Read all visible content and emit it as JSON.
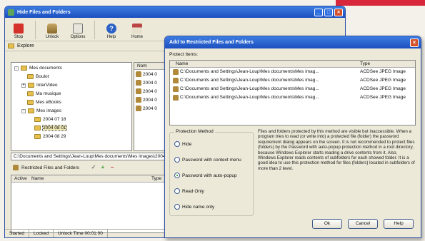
{
  "main": {
    "title": "Hide Files and Folders",
    "toolbar": [
      {
        "label": "Stop",
        "icon": "stop-icon"
      },
      {
        "label": "Unlock",
        "icon": "unlock-icon"
      },
      {
        "label": "Options",
        "icon": "options-icon"
      },
      {
        "label": "Help",
        "icon": "help-icon"
      },
      {
        "label": "Home",
        "icon": "home-icon"
      }
    ],
    "explore_label": "Explore",
    "tree": [
      {
        "label": "Mes documents",
        "level": 0
      },
      {
        "label": "Boulot",
        "level": 1
      },
      {
        "label": "InterVideo",
        "level": 1
      },
      {
        "label": "Ma musique",
        "level": 1
      },
      {
        "label": "Mes eBooks",
        "level": 1
      },
      {
        "label": "Mes images",
        "level": 1
      },
      {
        "label": "2004 07 18",
        "level": 2
      },
      {
        "label": "2004 08 01",
        "level": 2
      },
      {
        "label": "2004 08 29",
        "level": 2
      }
    ],
    "list_header": "Nom",
    "list_rows": [
      "2004 0",
      "2004 0",
      "2004 0",
      "2004 0",
      "2004 0"
    ],
    "path": "C:\\Documents and Settings\\Jean-Loup\\Mes documents\\Mes images\\2004 08 01",
    "restricted_label": "Restricted Files and Folders",
    "restricted_columns": {
      "active": "Active",
      "name": "Name",
      "type": "Type"
    },
    "status": {
      "started": "Started",
      "locked": "Locked",
      "unlock_time": "Unlock Time 00:01:00"
    }
  },
  "dialog": {
    "title": "Add to Restricted Files and Folders",
    "protect_label": "Protect Items:",
    "columns": {
      "name": "Name",
      "type": "Type"
    },
    "items": [
      {
        "name": "C:\\Documents and Settings\\Jean-Loup\\Mes documents\\Mes imag...",
        "type": "ACDSee JPEG Image"
      },
      {
        "name": "C:\\Documents and Settings\\Jean-Loup\\Mes documents\\Mes imag...",
        "type": "ACDSee JPEG Image"
      },
      {
        "name": "C:\\Documents and Settings\\Jean-Loup\\Mes documents\\Mes imag...",
        "type": "ACDSee JPEG Image"
      },
      {
        "name": "C:\\Documents and Settings\\Jean-Loup\\Mes documents\\Mes imag...",
        "type": "ACDSee JPEG Image"
      }
    ],
    "method_label": "Protection Method",
    "methods": [
      {
        "label": "Hide",
        "selected": false
      },
      {
        "label": "Password with context menu",
        "selected": false
      },
      {
        "label": "Password with auto-popup",
        "selected": true
      },
      {
        "label": "Read Only",
        "selected": false
      },
      {
        "label": "Hide name only",
        "selected": false
      }
    ],
    "description": "Files and folders protected by this method are visible but inaccessible. When a program tries to read (or write into) a protected file (folder) the password requirement dialog appears on the screen. It is not recommended to protect files (folders) by the Password with auto-popup protection method in a root directory, because Windows Explorer starts reading a drive contents from it. Also, Windows Explorer reads contents of subfolders for each showed folder. It is a good idea to use this protection method for files (folders) located in subfolders of more than 2 level.",
    "buttons": {
      "ok": "Ok",
      "cancel": "Cancel",
      "help": "Help"
    }
  },
  "colors": {
    "titlebar": "#1c4fc0",
    "dialog_bg": "#ece9d8",
    "accent_red": "#d8263a"
  }
}
